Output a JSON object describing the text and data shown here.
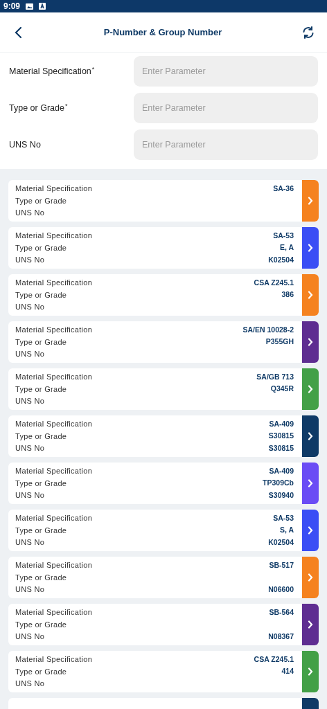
{
  "status_bar": {
    "time": "9:09"
  },
  "header": {
    "title": "P-Number & Group Number"
  },
  "form": [
    {
      "label": "Material Specification",
      "required_mark": "*",
      "placeholder": "Enter Parameter"
    },
    {
      "label": "Type or Grade",
      "required_mark": "*",
      "placeholder": "Enter Parameter"
    },
    {
      "label": "UNS No",
      "placeholder": "Enter Parameter"
    }
  ],
  "results": [
    {
      "color": "#f5821f",
      "fields": [
        {
          "label": "Material Specification",
          "value": "SA-36"
        },
        {
          "label": "Type or Grade"
        },
        {
          "label": "UNS No"
        }
      ]
    },
    {
      "color": "#3a4ef5",
      "fields": [
        {
          "label": "Material Specification",
          "value": "SA-53"
        },
        {
          "label": "Type or Grade",
          "value": "E, A"
        },
        {
          "label": "UNS No",
          "value": "K02504"
        }
      ]
    },
    {
      "color": "#f5821f",
      "fields": [
        {
          "label": "Material Specification",
          "value": "CSA Z245.1"
        },
        {
          "label": "Type or Grade",
          "value": "386"
        },
        {
          "label": "UNS No"
        }
      ]
    },
    {
      "color": "#5e2d91",
      "fields": [
        {
          "label": "Material Specification",
          "value": "SA/EN 10028-2"
        },
        {
          "label": "Type or Grade",
          "value": "P355GH"
        },
        {
          "label": "UNS No"
        }
      ]
    },
    {
      "color": "#43a047",
      "fields": [
        {
          "label": "Material Specification",
          "value": "SA/GB 713"
        },
        {
          "label": "Type or Grade",
          "value": "Q345R"
        },
        {
          "label": "UNS No"
        }
      ]
    },
    {
      "color": "#0f3a66",
      "fields": [
        {
          "label": "Material Specification",
          "value": "SA-409"
        },
        {
          "label": "Type or Grade",
          "value": "S30815"
        },
        {
          "label": "UNS No",
          "value": "S30815"
        }
      ]
    },
    {
      "color": "#6a4cf5",
      "fields": [
        {
          "label": "Material Specification",
          "value": "SA-409"
        },
        {
          "label": "Type or Grade",
          "value": "TP309Cb"
        },
        {
          "label": "UNS No",
          "value": "S30940"
        }
      ]
    },
    {
      "color": "#3a4ef5",
      "fields": [
        {
          "label": "Material Specification",
          "value": "SA-53"
        },
        {
          "label": "Type or Grade",
          "value": "S, A"
        },
        {
          "label": "UNS No",
          "value": "K02504"
        }
      ]
    },
    {
      "color": "#f5821f",
      "fields": [
        {
          "label": "Material Specification",
          "value": "SB-517"
        },
        {
          "label": "Type or Grade"
        },
        {
          "label": "UNS No",
          "value": "N06600"
        }
      ]
    },
    {
      "color": "#5e2d91",
      "fields": [
        {
          "label": "Material Specification",
          "value": "SB-564"
        },
        {
          "label": "Type or Grade"
        },
        {
          "label": "UNS No",
          "value": "N08367"
        }
      ]
    },
    {
      "color": "#43a047",
      "fields": [
        {
          "label": "Material Specification",
          "value": "CSA Z245.1"
        },
        {
          "label": "Type or Grade",
          "value": "414"
        },
        {
          "label": "UNS No"
        }
      ]
    },
    {
      "color": "#0f3a66"
    }
  ]
}
